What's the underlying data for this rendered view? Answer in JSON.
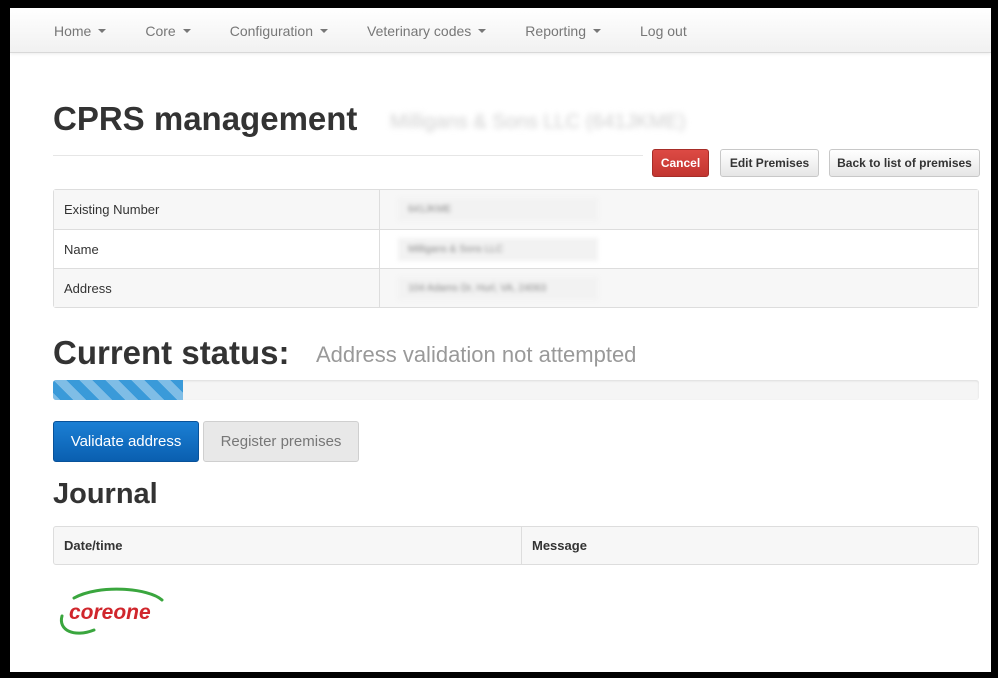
{
  "nav": {
    "items": [
      {
        "label": "Home",
        "dropdown": true
      },
      {
        "label": "Core",
        "dropdown": true
      },
      {
        "label": "Configuration",
        "dropdown": true
      },
      {
        "label": "Veterinary codes",
        "dropdown": true
      },
      {
        "label": "Reporting",
        "dropdown": true
      },
      {
        "label": "Log out",
        "dropdown": false
      }
    ]
  },
  "page": {
    "title": "CPRS management",
    "subtitle": "Milligans & Sons LLC (641JKME)"
  },
  "actions": {
    "cancel": "Cancel",
    "edit": "Edit Premises",
    "back": "Back to list of premises"
  },
  "info": {
    "rows": [
      {
        "label": "Existing Number",
        "value": "641JKME"
      },
      {
        "label": "Name",
        "value": "Milligans & Sons LLC"
      },
      {
        "label": "Address",
        "value": "104 Adams Dr, Hurl, VA, 24063"
      }
    ]
  },
  "status": {
    "heading": "Current status:",
    "text": "Address validation not attempted",
    "progress_percent": 14,
    "progress_color": "#3a9ad9"
  },
  "buttons": {
    "validate": "Validate address",
    "register": "Register premises"
  },
  "journal": {
    "title": "Journal",
    "columns": [
      "Date/time",
      "Message"
    ]
  },
  "logo": {
    "text": "coreone",
    "text_color": "#d0262c",
    "swoosh_color": "#3aa63e"
  }
}
